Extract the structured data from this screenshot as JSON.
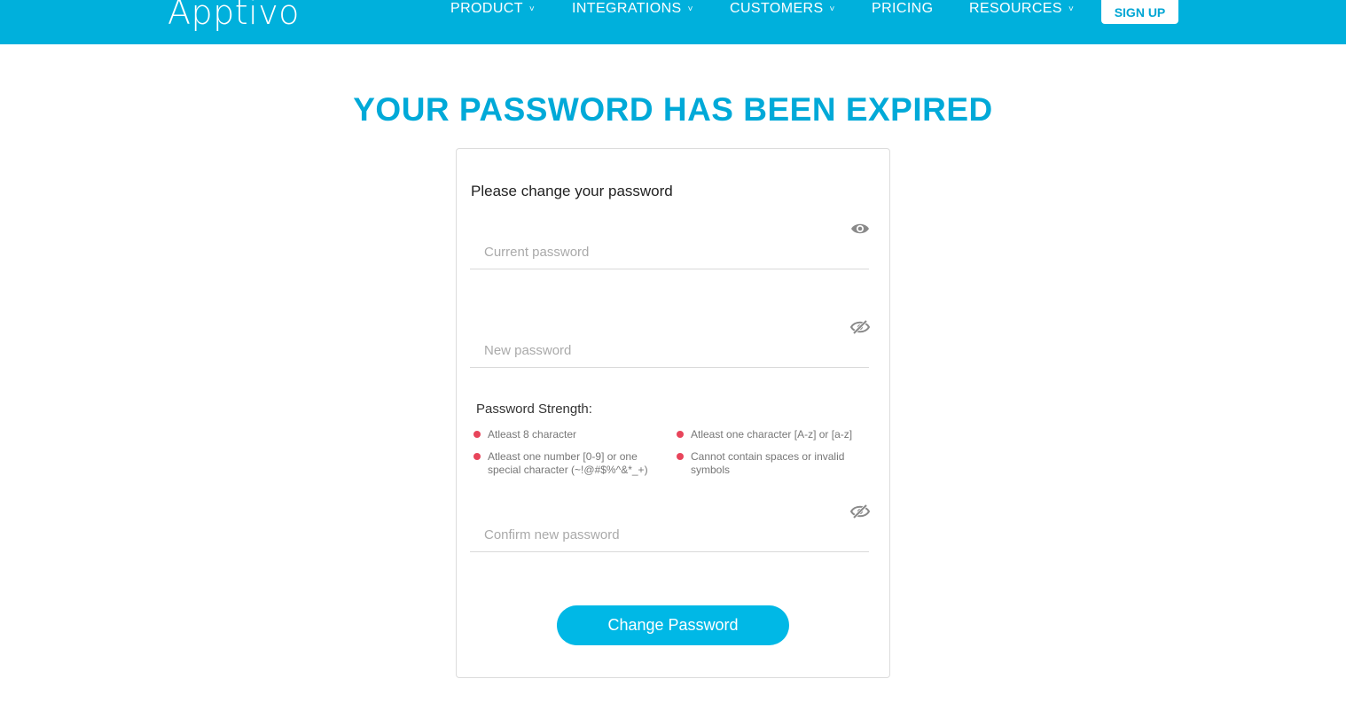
{
  "brand": {
    "logo_text": "Apptivo",
    "accent": "#00b0dc",
    "title_color": "#00a9d8",
    "error_dot": "#e8455b"
  },
  "nav": {
    "items": [
      {
        "label": "PRODUCT",
        "has_dropdown": true
      },
      {
        "label": "INTEGRATIONS",
        "has_dropdown": true
      },
      {
        "label": "CUSTOMERS",
        "has_dropdown": true
      },
      {
        "label": "PRICING",
        "has_dropdown": false
      },
      {
        "label": "RESOURCES",
        "has_dropdown": true
      }
    ],
    "dropdown_caret": "˅",
    "signup_label": "SIGN UP"
  },
  "page": {
    "title": "YOUR PASSWORD HAS BEEN EXPIRED"
  },
  "form": {
    "subtitle": "Please change your password",
    "current_password": {
      "placeholder": "Current password",
      "value": "",
      "icon": "eye-icon"
    },
    "new_password": {
      "placeholder": "New password",
      "value": "",
      "icon": "eye-slash-icon"
    },
    "confirm_password": {
      "placeholder": "Confirm new password",
      "value": "",
      "icon": "eye-slash-icon"
    },
    "strength": {
      "label": "Password Strength:",
      "rules": [
        {
          "text": "Atleast 8 character"
        },
        {
          "text": "Atleast one character [A-z] or [a-z]"
        },
        {
          "text": "Atleast one number [0-9] or one special character (~!@#$%^&*_+)"
        },
        {
          "text": "Cannot contain spaces or invalid symbols"
        }
      ]
    },
    "submit_label": "Change Password"
  }
}
